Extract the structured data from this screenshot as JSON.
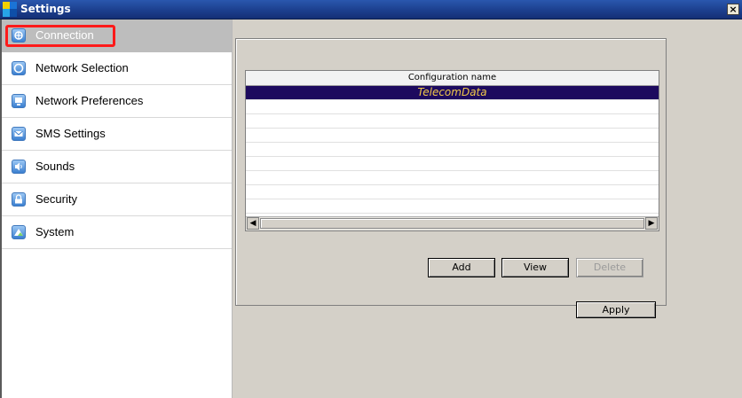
{
  "window": {
    "title": "Settings",
    "close_glyph": "×"
  },
  "sidebar": {
    "items": [
      {
        "label": "Connection",
        "icon": "connection-icon",
        "active": true
      },
      {
        "label": "Network Selection",
        "icon": "network-selection-icon"
      },
      {
        "label": "Network Preferences",
        "icon": "network-preferences-icon"
      },
      {
        "label": "SMS Settings",
        "icon": "sms-icon"
      },
      {
        "label": "Sounds",
        "icon": "speaker-icon"
      },
      {
        "label": "Security",
        "icon": "lock-icon"
      },
      {
        "label": "System",
        "icon": "system-icon"
      }
    ]
  },
  "main": {
    "table": {
      "column_header": "Configuration name",
      "rows": [
        "TelecomData"
      ]
    },
    "buttons": {
      "add": "Add",
      "view": "View",
      "delete": "Delete",
      "apply": "Apply"
    }
  },
  "colors": {
    "selection_bg": "#1d0a5e",
    "selection_text": "#f0c84a",
    "highlight_ring": "#ff1a1a",
    "active_nav": "#bdbdbd",
    "panel_bg": "#d4d0c8"
  }
}
